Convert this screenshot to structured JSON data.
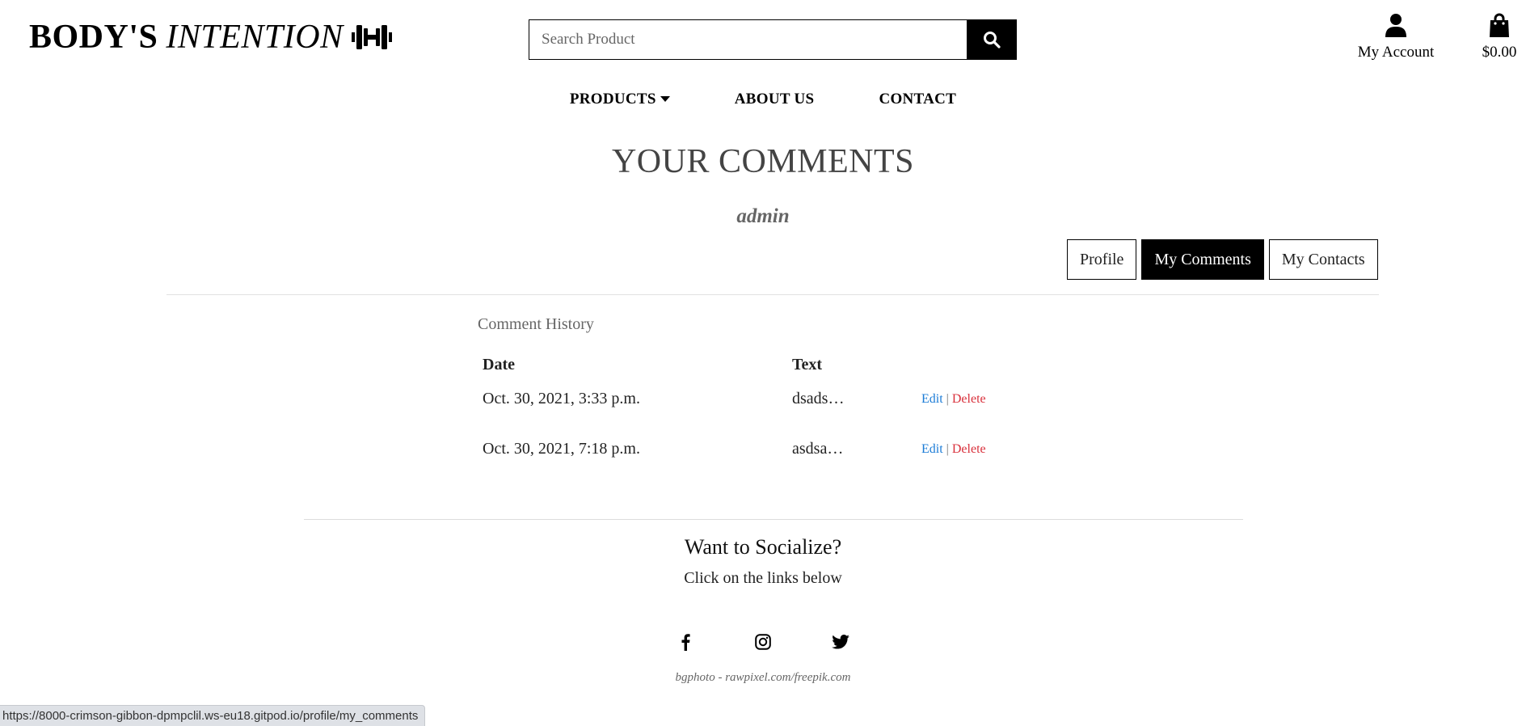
{
  "header": {
    "brand_bold": "BODY'S",
    "brand_italic": "INTENTION",
    "search_placeholder": "Search Product",
    "account_label": "My Account",
    "cart_total": "$0.00"
  },
  "nav": {
    "products": "PRODUCTS",
    "about": "ABOUT US",
    "contact": "CONTACT"
  },
  "page": {
    "title": "YOUR COMMENTS",
    "username": "admin",
    "tabs": [
      {
        "label": "Profile",
        "active": false
      },
      {
        "label": "My Comments",
        "active": true
      },
      {
        "label": "My Contacts",
        "active": false
      }
    ]
  },
  "history": {
    "title": "Comment History",
    "columns": [
      "Date",
      "Text"
    ],
    "rows": [
      {
        "date": "Oct. 30, 2021, 3:33 p.m.",
        "text": "dsads…",
        "edit": "Edit",
        "sep": "|",
        "delete": "Delete"
      },
      {
        "date": "Oct. 30, 2021, 7:18 p.m.",
        "text": "asdsa…",
        "edit": "Edit",
        "sep": "|",
        "delete": "Delete"
      }
    ]
  },
  "footer": {
    "title": "Want to Socialize?",
    "subtitle": "Click on the links below",
    "social_icons": [
      "facebook-icon",
      "instagram-icon",
      "twitter-icon"
    ],
    "credit": "bgphoto - rawpixel.com/freepik.com"
  },
  "status_bar": {
    "url": "https://8000-crimson-gibbon-dpmpclil.ws-eu18.gitpod.io/profile/my_comments"
  },
  "colors": {
    "accent_black": "#000000",
    "edit_link": "#1a7bd6",
    "delete_link": "#d9313c"
  }
}
